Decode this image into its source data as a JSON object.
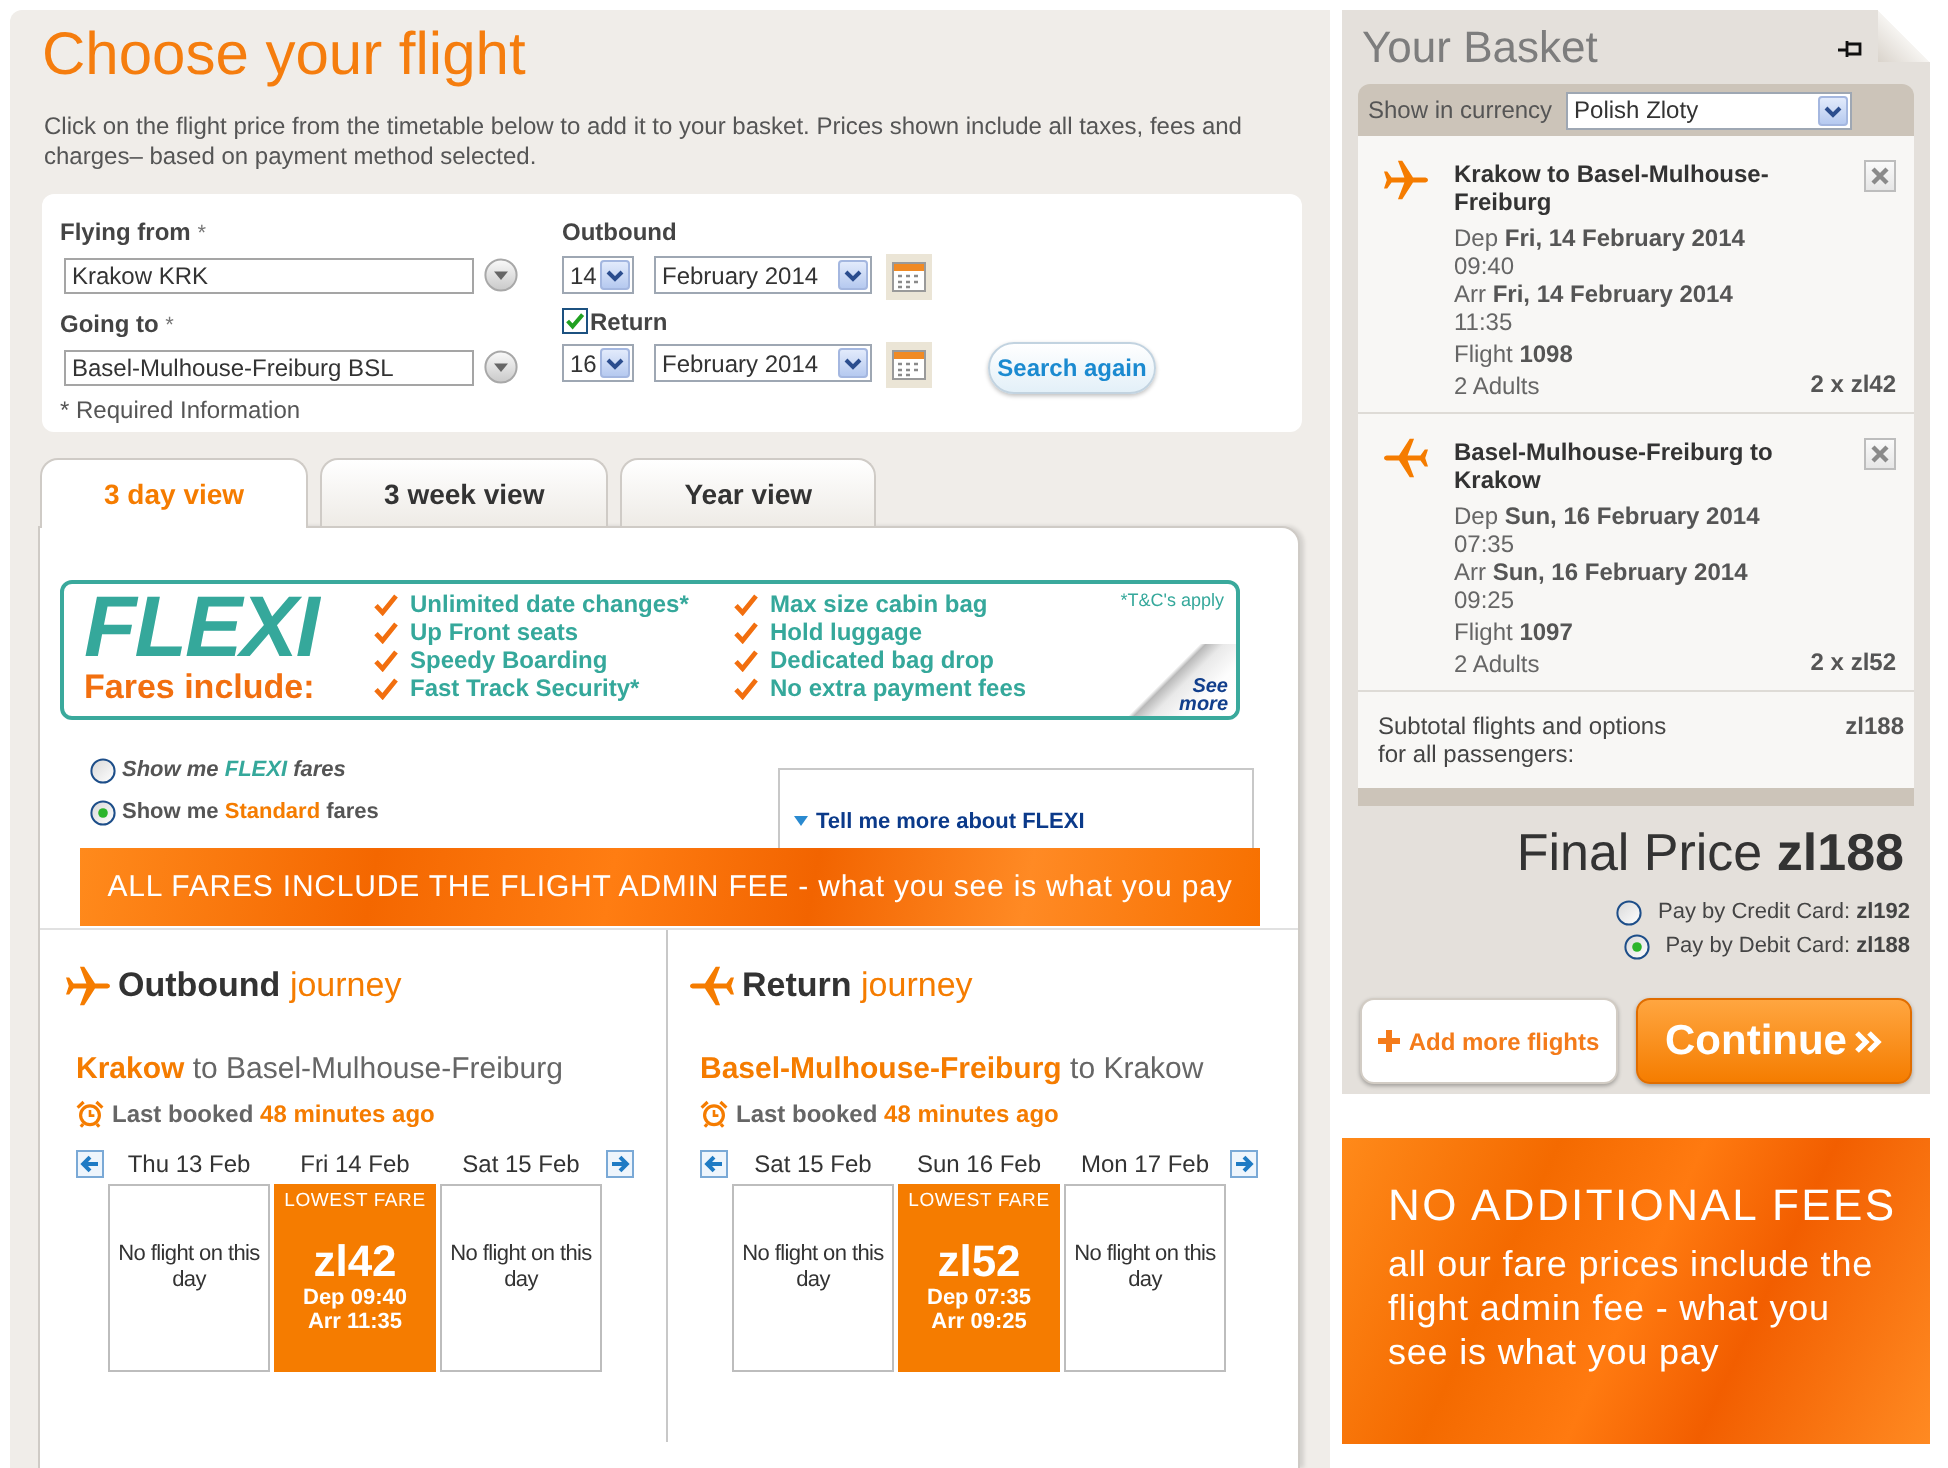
{
  "title": "Choose your flight",
  "intro": "Click on the flight price from the timetable below to add it to your basket. Prices shown include all taxes, fees and charges– based on payment method selected.",
  "search_form": {
    "from": {
      "label": "Flying from",
      "required_mark": "*",
      "value": "Krakow KRK"
    },
    "to": {
      "label": "Going to",
      "required_mark": "*",
      "value": "Basel-Mulhouse-Freiburg BSL"
    },
    "required_note": "* Required Information",
    "outbound": {
      "label": "Outbound",
      "day": "14",
      "month": "February 2014"
    },
    "return": {
      "label": "Return",
      "checked": true,
      "day": "16",
      "month": "February 2014"
    },
    "search_button": "Search again"
  },
  "tabs": [
    {
      "label": "3 day view",
      "selected": true
    },
    {
      "label": "3 week view",
      "selected": false
    },
    {
      "label": "Year view",
      "selected": false
    }
  ],
  "flexi_banner": {
    "logo": "FLEXI",
    "subtitle": "Fares include:",
    "feature_columns": [
      [
        "Unlimited date changes*",
        "Up Front seats",
        "Speedy Boarding",
        "Fast Track Security*"
      ],
      [
        "Max size cabin bag",
        "Hold luggage",
        "Dedicated bag drop",
        "No extra payment fees"
      ]
    ],
    "terms": "*T&C's apply",
    "see_more": "See more"
  },
  "fare_options": [
    {
      "kind": "flexi",
      "prefix": "Show me",
      "highlight": "FLEXI",
      "suffix": "fares",
      "selected": false
    },
    {
      "kind": "standard",
      "prefix": "Show me",
      "highlight": "Standard",
      "suffix": "fares",
      "selected": true
    }
  ],
  "tell_more_link": "Tell me more about FLEXI",
  "admin_fee_banner": "ALL FARES INCLUDE THE FLIGHT ADMIN FEE - what you see is what you pay",
  "journeys": [
    {
      "kind": "outbound",
      "heading": "Outbound",
      "heading_suffix": "journey",
      "origin": "Krakow",
      "route_rest": "to Basel-Mulhouse-Freiburg",
      "last_booked_label": "Last booked",
      "last_booked_value": "48 minutes ago",
      "days": [
        {
          "label": "Thu 13 Feb",
          "kind": "no_flight",
          "text": "No flight on this day"
        },
        {
          "label": "Fri 14 Feb",
          "kind": "fare",
          "badge": "LOWEST FARE",
          "price": "zl42",
          "dep": "Dep 09:40",
          "arr": "Arr 11:35"
        },
        {
          "label": "Sat 15 Feb",
          "kind": "no_flight",
          "text": "No flight on this day"
        }
      ]
    },
    {
      "kind": "return",
      "heading": "Return",
      "heading_suffix": "journey",
      "origin": "Basel-Mulhouse-Freiburg",
      "route_rest": "to Krakow",
      "last_booked_label": "Last booked",
      "last_booked_value": "48 minutes ago",
      "days": [
        {
          "label": "Sat 15 Feb",
          "kind": "no_flight",
          "text": "No flight on this day"
        },
        {
          "label": "Sun 16 Feb",
          "kind": "fare",
          "badge": "LOWEST FARE",
          "price": "zl52",
          "dep": "Dep 07:35",
          "arr": "Arr 09:25"
        },
        {
          "label": "Mon 17 Feb",
          "kind": "no_flight",
          "text": "No flight on this day"
        }
      ]
    }
  ],
  "basket": {
    "title": "Your Basket",
    "currency_label": "Show in currency",
    "currency": "Polish Zloty",
    "items": [
      {
        "kind": "outbound",
        "route": "Krakow to Basel-Mulhouse-Freiburg",
        "dep_label": "Dep",
        "dep_date": "Fri, 14 February 2014",
        "dep_time": "09:40",
        "arr_label": "Arr",
        "arr_date": "Fri, 14 February 2014",
        "arr_time": "11:35",
        "flight_label": "Flight",
        "flight_number": "1098",
        "passengers": "2 Adults",
        "price": "2 x zl42"
      },
      {
        "kind": "return",
        "route": "Basel-Mulhouse-Freiburg to Krakow",
        "dep_label": "Dep",
        "dep_date": "Sun, 16 February 2014",
        "dep_time": "07:35",
        "arr_label": "Arr",
        "arr_date": "Sun, 16 February 2014",
        "arr_time": "09:25",
        "flight_label": "Flight",
        "flight_number": "1097",
        "passengers": "2 Adults",
        "price": "2 x zl52"
      }
    ],
    "subtotal_label": "Subtotal flights and options for all passengers:",
    "subtotal": "zl188"
  },
  "final_price": {
    "label": "Final Price",
    "value": "zl188"
  },
  "payment_options": [
    {
      "label": "Pay by Credit Card:",
      "amount": "zl192",
      "selected": false
    },
    {
      "label": "Pay by Debit Card:",
      "amount": "zl188",
      "selected": true
    }
  ],
  "add_flights_button": "Add more flights",
  "continue_button": "Continue",
  "promo": {
    "title": "NO ADDITIONAL FEES",
    "text": "all our fare prices include the flight admin fee - what you see is what you pay"
  }
}
